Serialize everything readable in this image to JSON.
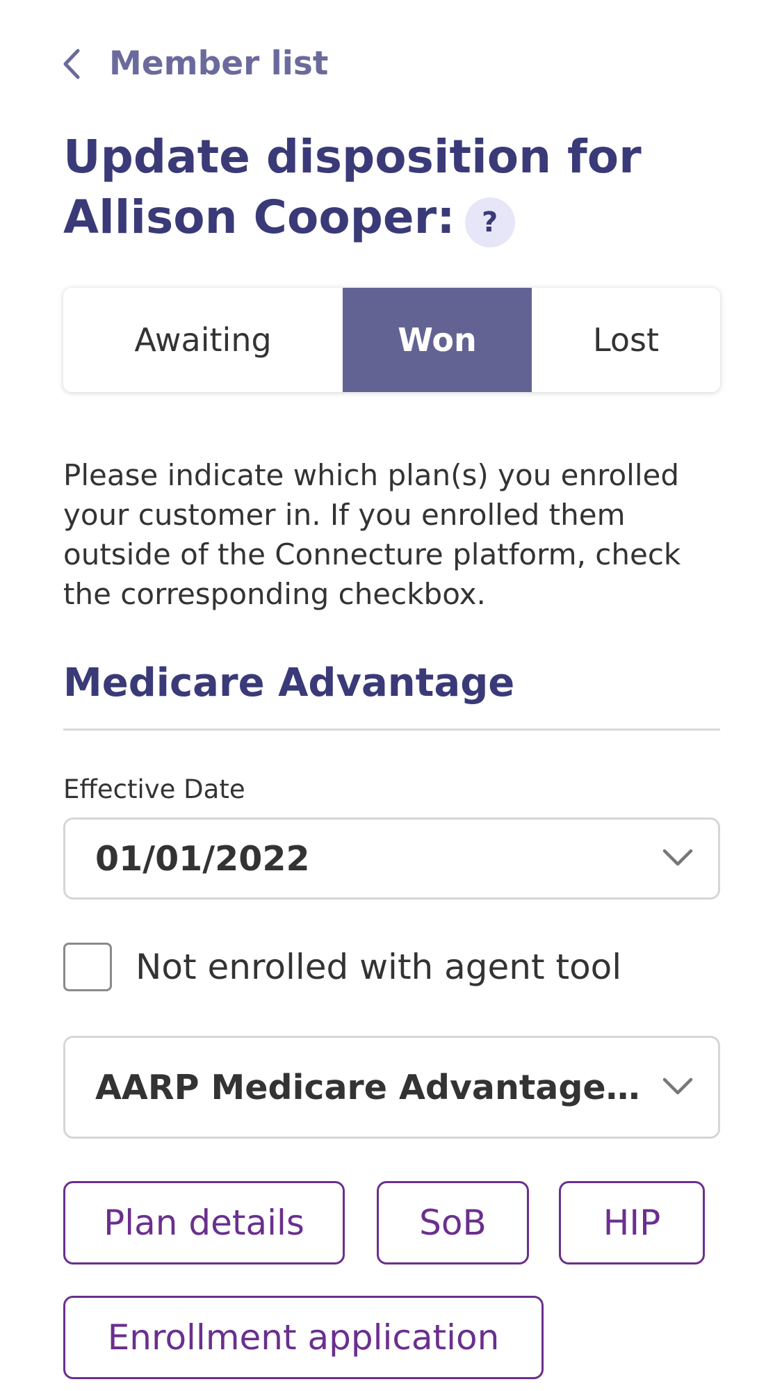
{
  "nav": {
    "back_label": "Member list"
  },
  "header": {
    "title_line1": "Update disposition for",
    "title_line2": "Allison Cooper:",
    "help_symbol": "?"
  },
  "disposition_tabs": {
    "items": [
      {
        "label": "Awaiting",
        "selected": false
      },
      {
        "label": "Won",
        "selected": true
      },
      {
        "label": "Lost",
        "selected": false
      }
    ]
  },
  "instructions": "Please indicate which plan(s) you enrolled your customer in. If you enrolled them outside of the Connecture platform, check the corresponding checkbox.",
  "section": {
    "title": "Medicare Advantage",
    "effective_date_label": "Effective Date",
    "effective_date_value": "01/01/2022",
    "not_enrolled_label": "Not enrolled with agent tool",
    "not_enrolled_checked": false,
    "plan_value": "AARP Medicare Advantage Pat…",
    "buttons": {
      "plan_details": "Plan details",
      "sob": "SoB",
      "hip": "HIP",
      "enrollment_application": "Enrollment application"
    }
  },
  "colors": {
    "title": "#3a3a78",
    "back_link": "#6a6a9c",
    "selected_tab": "#636393",
    "outline_button": "#6a2f8e",
    "help_badge_bg": "#e6e6f8"
  },
  "icons": {
    "back": "chevron-left-icon",
    "dropdown": "chevron-down-icon",
    "help": "question-mark-icon"
  }
}
